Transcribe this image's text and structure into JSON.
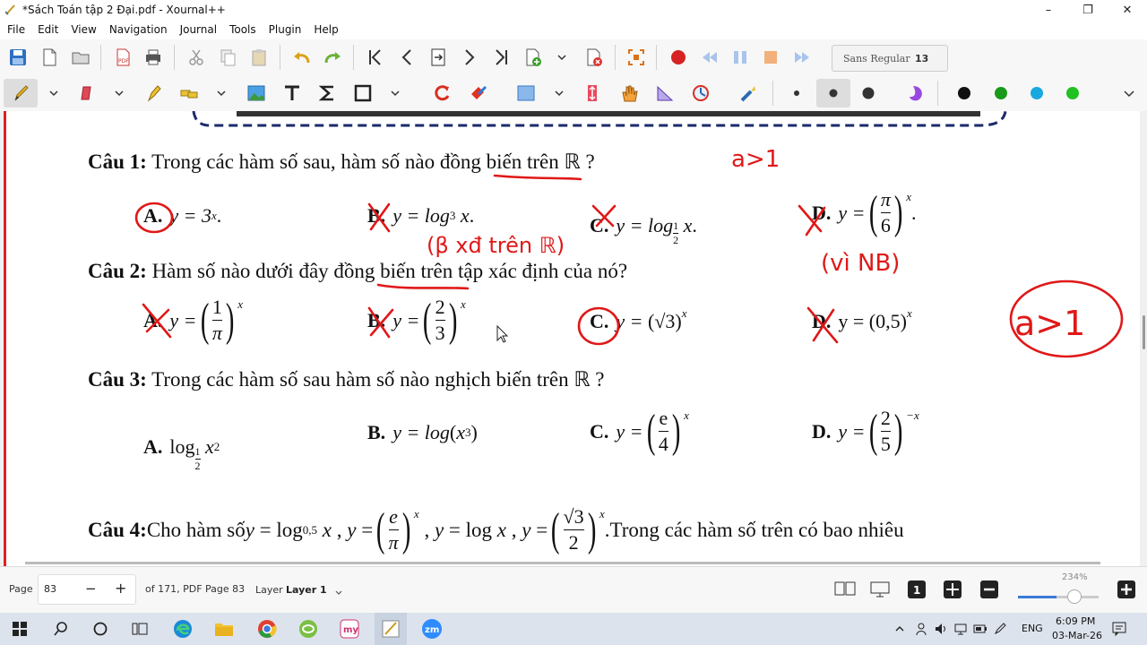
{
  "window": {
    "title": "*Sách Toán tập 2 Đại.pdf - Xournal++",
    "minimize_glyph": "–",
    "restore_glyph": "❐",
    "close_glyph": "✕"
  },
  "menu": [
    "File",
    "Edit",
    "View",
    "Navigation",
    "Journal",
    "Tools",
    "Plugin",
    "Help"
  ],
  "toolbar": {
    "font_name": "Sans Regular",
    "font_size": "13",
    "colors": [
      "#111111",
      "#1a9a1a",
      "#1aa8e0",
      "#22c022"
    ],
    "icons_row1": [
      "save-icon",
      "new-page-icon",
      "open-icon",
      "export-pdf-icon",
      "print-icon",
      "cut-icon",
      "copy-icon",
      "paste-icon",
      "undo-icon",
      "redo-icon",
      "first-page-icon",
      "previous-page-icon",
      "goto-page-icon",
      "next-page-icon",
      "last-page-icon",
      "insert-page-icon",
      "delete-page-icon",
      "fullscreen-icon",
      "record-icon",
      "rewind-icon",
      "pause-icon",
      "stop-icon",
      "fast-forward-icon"
    ],
    "icons_row2": [
      "pen-icon",
      "eraser-icon",
      "highlighter-icon",
      "select-icon",
      "image-icon",
      "text-icon",
      "tex-icon",
      "shape-icon",
      "undo-redo-icon",
      "fill-icon",
      "rectangle-icon",
      "vertical-space-icon",
      "hand-icon",
      "ruler-icon",
      "arrow-circle-icon",
      "laser-icon"
    ]
  },
  "document": {
    "q1": {
      "label": "Câu 1:",
      "text": " Trong các hàm số sau, hàm số nào đồng biến trên ℝ ?"
    },
    "q1_opts": {
      "a": {
        "label": "A.",
        "expr": "y = 3"
      },
      "b": {
        "label": "B.",
        "expr": "y = log"
      },
      "c": {
        "label": "C.",
        "expr": "y = log"
      },
      "d": {
        "label": "D.",
        "expr": "y ="
      }
    },
    "q2": {
      "label": "Câu 2:",
      "text": "  Hàm số nào dưới đây đồng biến trên tập xác định của nó?"
    },
    "q2_opts": {
      "a": {
        "label": "A.",
        "expr": "y ="
      },
      "b": {
        "label": "B.",
        "expr": "y ="
      },
      "c": {
        "label": "C.",
        "expr": "y ="
      },
      "d": {
        "label": "D.",
        "expr": "y = (0,5)"
      }
    },
    "q3": {
      "label": "Câu 3:",
      "text": " Trong các hàm số sau hàm số nào nghịch biến trên ℝ ?"
    },
    "q3_opts": {
      "a": {
        "label": "A.",
        "expr": "log"
      },
      "b": {
        "label": "B.",
        "expr": "y = log"
      },
      "c": {
        "label": "C.",
        "expr": "y ="
      },
      "d": {
        "label": "D.",
        "expr": "y ="
      }
    },
    "q4": {
      "label": "Câu 4:",
      "text": " Cho hàm số ",
      "tail": ".Trong các hàm số trên có bao nhiêu"
    },
    "annotations": {
      "a1": "a>1",
      "note_b": "(β xđ trên ℝ)",
      "note_d": "(vì NB)",
      "a2": "a>1"
    }
  },
  "status": {
    "page_label": "Page",
    "page_value": "83",
    "minus": "−",
    "plus": "+",
    "page_info": "of 171, PDF Page 83",
    "layer_label": "Layer",
    "layer_value": "Layer 1",
    "zoom": "234%",
    "zoom_level": 0.48
  },
  "taskbar": {
    "lang": "ENG",
    "time": "6:09 PM",
    "date": "03-Mar-26"
  }
}
